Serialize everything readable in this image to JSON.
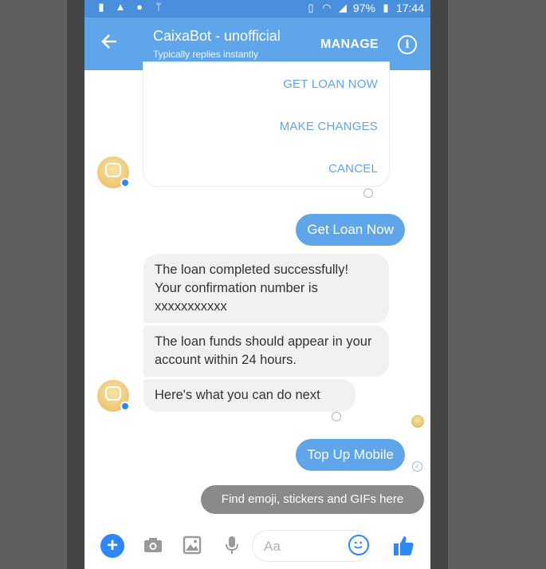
{
  "status_bar": {
    "battery": "97%",
    "time": "17:44"
  },
  "header": {
    "title": "CaixaBot - unofficial",
    "subtitle": "Typically replies instantly",
    "manage_label": "MANAGE"
  },
  "card": {
    "buttons": [
      "GET LOAN NOW",
      "MAKE CHANGES",
      "CANCEL"
    ]
  },
  "messages": {
    "out1": "Get Loan Now",
    "in1": "The loan completed successfully! Your confirmation number is xxxxxxxxxxx",
    "in2": "The loan funds should appear in your account within 24 hours.",
    "in3": "Here's what you can do next",
    "out2": "Top Up Mobile"
  },
  "tooltip": "Find emoji, stickers and GIFs here",
  "composer": {
    "placeholder": "Aa"
  },
  "colors": {
    "accent": "#5ea5ea",
    "messenger_blue": "#2d88ff",
    "bubble_in": "#f1f1f1"
  },
  "icons": [
    "back-arrow-icon",
    "info-icon",
    "plus-icon",
    "camera-icon",
    "image-icon",
    "mic-icon",
    "emoji-icon",
    "thumbs-up-icon"
  ]
}
